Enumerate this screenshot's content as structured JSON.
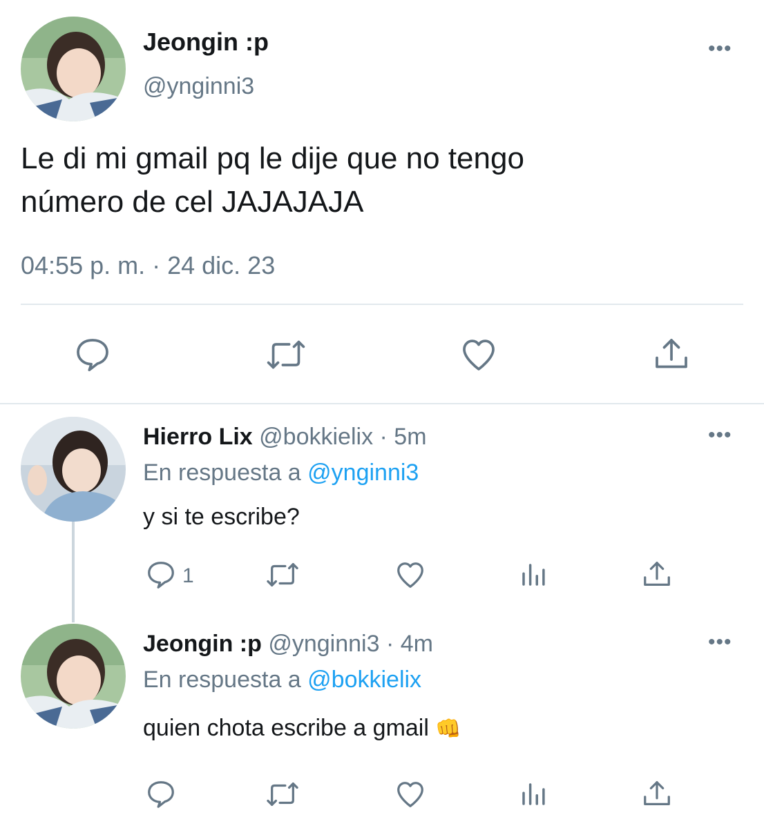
{
  "main_tweet": {
    "display_name": "Jeongin :p",
    "handle": "@ynginni3",
    "text_line1": "Le di mi gmail pq le dije que no tengo",
    "text_line2": "número de cel JAJAJAJA",
    "timestamp": "04:55 p. m. · 24 dic. 23",
    "more": "•••"
  },
  "replies": [
    {
      "display_name": "Hierro Lix",
      "handle": "@bokkielix",
      "time": "· 5m",
      "reply_prefix": "En respuesta a",
      "reply_to": "@ynginni3",
      "text": "y si te escribe?",
      "reply_count": "1",
      "more": "•••"
    },
    {
      "display_name": "Jeongin :p",
      "handle": "@ynginni3",
      "time": "· 4m",
      "reply_prefix": "En respuesta a",
      "reply_to": "@bokkielix",
      "text": "quien chota escribe a gmail",
      "emoji": "👊",
      "more": "•••"
    }
  ],
  "colors": {
    "text": "#14171a",
    "muted": "#657786",
    "link": "#1da1f2",
    "divider": "#e1e8ed"
  },
  "icons": [
    "reply-icon",
    "retweet-icon",
    "like-icon",
    "share-icon",
    "analytics-icon",
    "more-icon"
  ]
}
